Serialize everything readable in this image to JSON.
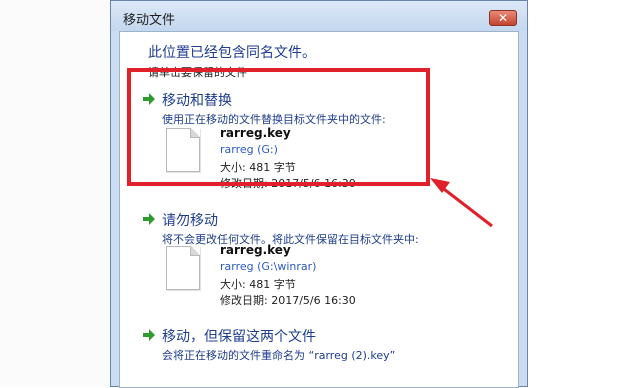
{
  "background": {
    "rows": [
      "20",
      "20",
      "20",
      "20",
      "20",
      "20",
      "20",
      "20",
      "20",
      "20",
      "20",
      "20",
      "20",
      "20",
      "20",
      "20",
      "20",
      "20",
      "20",
      "20"
    ]
  },
  "dialog": {
    "title": "移动文件",
    "heading": "此位置已经包含同名文件。",
    "subheading": "请单击要保留的文件",
    "options": [
      {
        "title": "移动和替换",
        "desc": "使用正在移动的文件替换目标文件夹中的文件:",
        "file": {
          "name": "rarreg.key",
          "location": "rarreg (G:)",
          "size": "大小: 481 字节",
          "date": "修改日期: 2017/5/6 16:30"
        }
      },
      {
        "title": "请勿移动",
        "desc": "将不会更改任何文件。将此文件保留在目标文件夹中:",
        "file": {
          "name": "rarreg.key",
          "location": "rarreg (G:\\winrar)",
          "size": "大小: 481 字节",
          "date": "修改日期: 2017/5/6 16:30"
        }
      },
      {
        "title": "移动，但保留这两个文件",
        "desc": "会将正在移动的文件重命名为 “rarreg (2).key”"
      }
    ]
  },
  "colors": {
    "accent": "#1e3d8f",
    "link": "#2c59c6",
    "highlight": "#e0202a",
    "arrow_green": "#2e9b2e"
  }
}
